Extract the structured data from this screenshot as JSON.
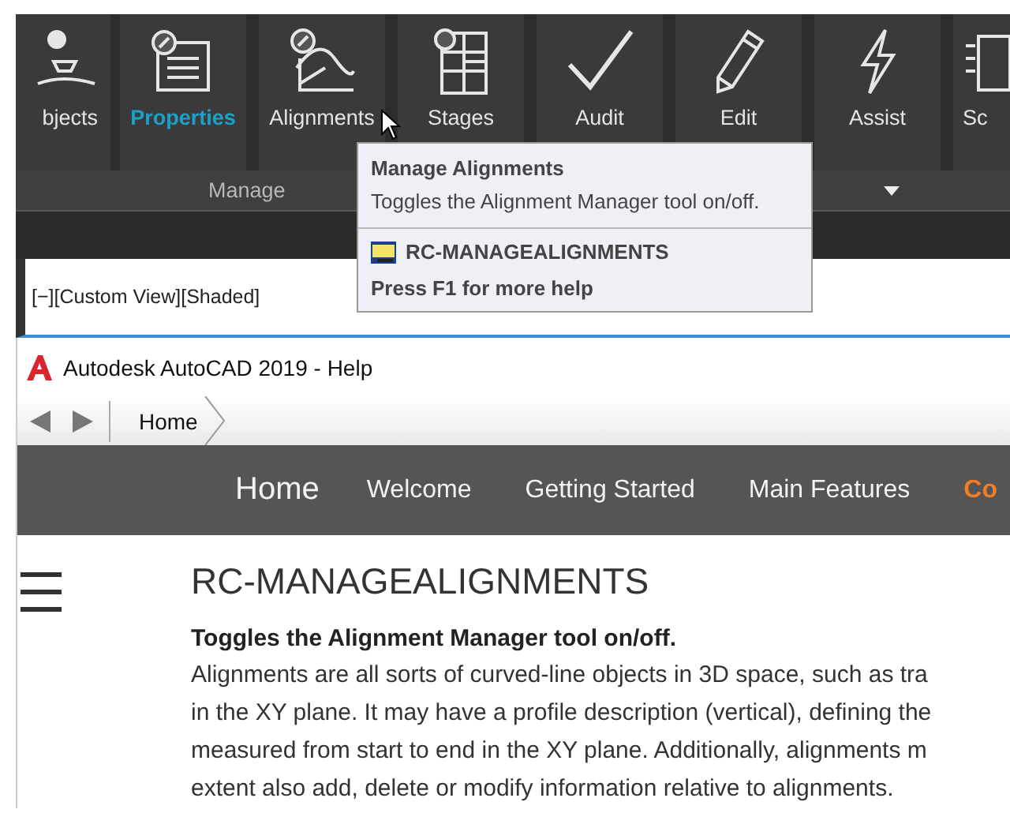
{
  "ribbon": {
    "buttons": [
      {
        "label": "bjects",
        "selected": false
      },
      {
        "label": "Properties",
        "selected": true
      },
      {
        "label": "Alignments",
        "selected": false
      },
      {
        "label": "Stages",
        "selected": false
      },
      {
        "label": "Audit",
        "selected": false
      },
      {
        "label": "Edit",
        "selected": false
      },
      {
        "label": "Assist",
        "selected": false
      },
      {
        "label": "Sc",
        "selected": false
      }
    ],
    "panel_label": "Manage"
  },
  "tooltip": {
    "title": "Manage Alignments",
    "description": "Toggles the Alignment Manager tool on/off.",
    "command": "RC-MANAGEALIGNMENTS",
    "help": "Press F1 for more help"
  },
  "viewport": {
    "label": "[−][Custom View][Shaded]"
  },
  "help_window": {
    "title": "Autodesk AutoCAD 2019 - Help",
    "breadcrumb": "Home",
    "nav": [
      {
        "label": "Home",
        "kind": "home"
      },
      {
        "label": "Welcome",
        "kind": "link"
      },
      {
        "label": "Getting Started",
        "kind": "link"
      },
      {
        "label": "Main Features",
        "kind": "link"
      },
      {
        "label": "Co",
        "kind": "accent"
      }
    ],
    "heading": "RC-MANAGEALIGNMENTS",
    "summary": "Toggles the Alignment Manager tool on/off.",
    "body_lines": [
      "Alignments are all sorts of curved-line objects in 3D space, such as tra",
      "in the XY plane. It may have a profile description (vertical), defining the",
      "measured from start to end in the XY plane. Additionally, alignments m",
      "extent also add, delete or modify information relative to alignments."
    ]
  }
}
